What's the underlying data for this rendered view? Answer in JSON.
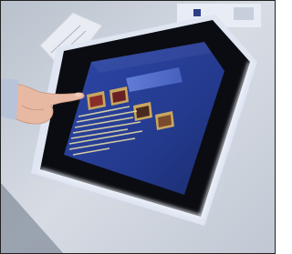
{
  "photo": {
    "subject": "kiosk-touchscreen",
    "colors": {
      "wall": "#c9cfd8",
      "glow": "#e8f0ff",
      "bezel": "#0a0a0f",
      "screen_bg": "#2a3d9a",
      "screen_accent": "#5d7ad8",
      "menu_text": "#f3e6a8"
    }
  },
  "screen": {
    "menu_items": [
      {
        "icon": "thumbnail-1"
      },
      {
        "icon": "thumbnail-2"
      },
      {
        "icon": "thumbnail-3"
      },
      {
        "icon": "thumbnail-4"
      }
    ]
  }
}
